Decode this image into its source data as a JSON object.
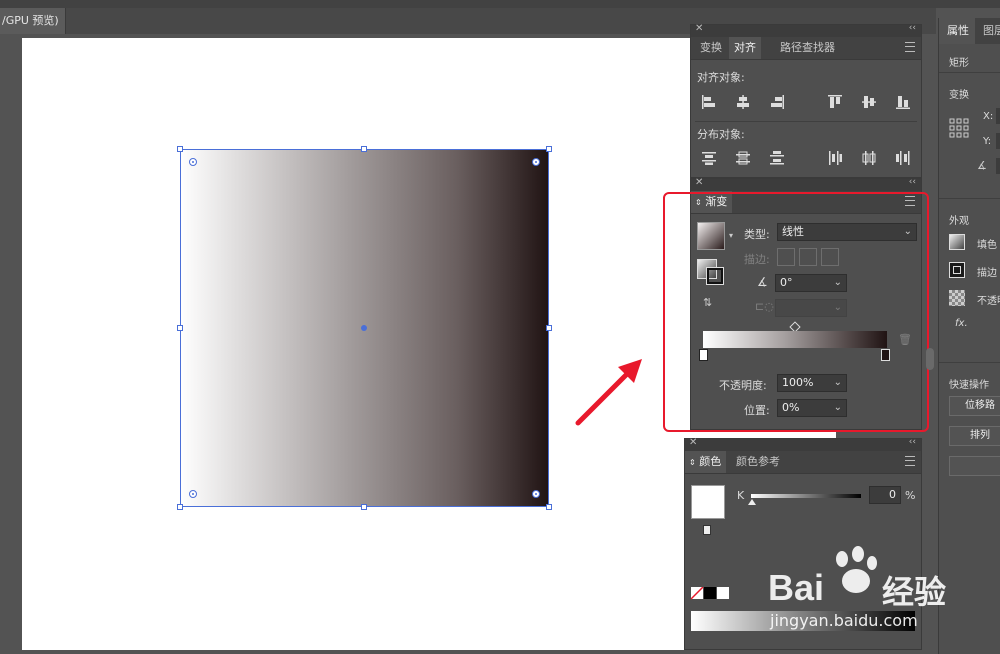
{
  "document": {
    "tab_title": "/GPU 预览)"
  },
  "align_panel": {
    "tabs": [
      "变换",
      "对齐",
      "路径查找器"
    ],
    "active_tab": "对齐",
    "align_objects_label": "对齐对象:",
    "distribute_objects_label": "分布对象:"
  },
  "gradient_panel": {
    "tab": "渐变",
    "type_label": "类型:",
    "type_value": "线性",
    "stroke_label": "描边:",
    "angle_value": "0°",
    "opacity_label": "不透明度:",
    "opacity_value": "100%",
    "location_label": "位置:",
    "location_value": "0%",
    "gradient_stops": [
      "#ffffff",
      "#201313"
    ]
  },
  "color_panel": {
    "tabs": [
      "颜色",
      "颜色参考"
    ],
    "active_tab": "颜色",
    "channel_label": "K",
    "channel_value": "0",
    "unit": "%"
  },
  "properties_panel": {
    "tabs": [
      "属性",
      "图层"
    ],
    "active_tab": "属性",
    "object_type": "矩形",
    "transform_label": "变换",
    "x_label": "X:",
    "y_label": "Y:",
    "appearance_label": "外观",
    "fill_label": "填色",
    "stroke_label": "描边",
    "opacity_label": "不透明",
    "fx_label": "fx.",
    "quick_actions_label": "快速操作",
    "button_offset": "位移路",
    "button_arrange": "排列"
  },
  "colors": {
    "highlight": "#e8192c",
    "selection": "#4a6fd8"
  },
  "watermark": {
    "brand": "Bai",
    "brand2": "经验",
    "url": "jingyan.baidu.com"
  }
}
